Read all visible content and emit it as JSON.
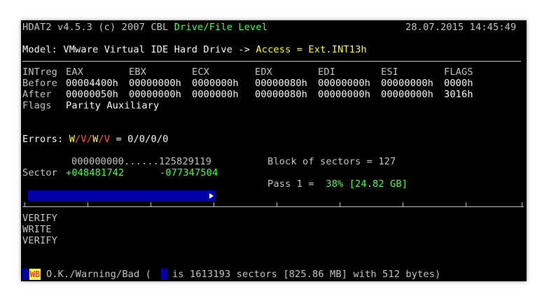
{
  "header": {
    "app": "HDAT2 v4.5.3 (c) 2007 CBL",
    "mode": "Drive/File Level",
    "datetime": "28.07.2015 14:45:49"
  },
  "model": {
    "label": "Model:",
    "value": "VMware Virtual IDE Hard Drive",
    "arrow": "->",
    "access": "Access = Ext.INT13h"
  },
  "registers": {
    "headers": [
      "INTreg",
      "EAX",
      "EBX",
      "ECX",
      "EDX",
      "EDI",
      "ESI",
      "FLAGS"
    ],
    "before": [
      "Before",
      "00004400h",
      "00000000h",
      "0000000h",
      "00000080h",
      "00000000h",
      "00000000h",
      "0000h"
    ],
    "after": [
      "After",
      "00000050h",
      "00000000h",
      "0000000h",
      "00000080h",
      "00000000h",
      "00000000h",
      "3016h"
    ],
    "flags_label": "Flags",
    "flags_value": "Parity Auxiliary"
  },
  "errors": {
    "label": "Errors:",
    "w": "W",
    "slash": "/",
    "v": "V",
    "value": "= 0/0/0/0"
  },
  "range": {
    "text": "000000000......125829119",
    "sector_label": "Sector",
    "sector_start": "+048481742",
    "sector_end": "-077347504"
  },
  "block": {
    "text": "Block of sectors = 127"
  },
  "pass": {
    "label": "Pass 1 =",
    "value": "38% [24.82 GB]",
    "progress": 0.38
  },
  "log": {
    "lines": [
      "VERIFY",
      "WRITE",
      "VERIFY"
    ]
  },
  "legend": {
    "badge": "WB",
    "text1": "O.K./Warning/Bad (",
    "text2": "is 1613193 sectors [825.86 MB] with 512 bytes)"
  }
}
